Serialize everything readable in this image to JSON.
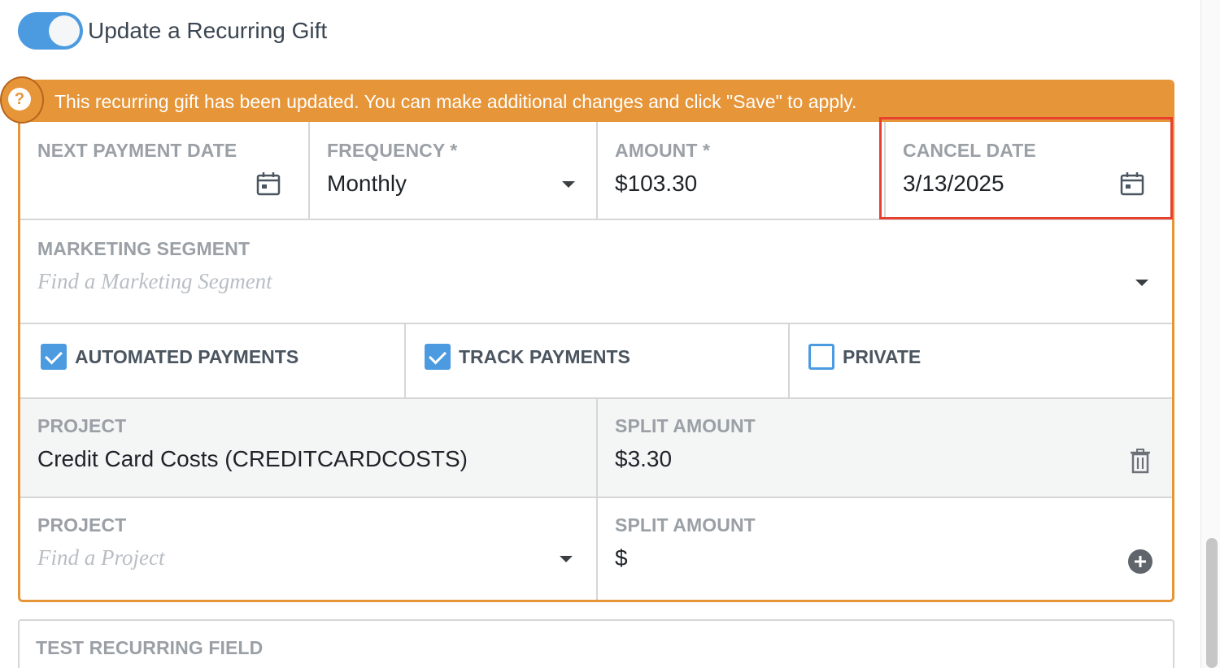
{
  "toggle": {
    "label": "Update a Recurring Gift",
    "on": true
  },
  "banner": {
    "text": "This recurring gift has been updated. You can make additional changes and click \"Save\" to apply.",
    "help_glyph": "?"
  },
  "fields": {
    "next_payment_date": {
      "label": "NEXT PAYMENT DATE",
      "value": ""
    },
    "frequency": {
      "label": "FREQUENCY *",
      "value": "Monthly"
    },
    "amount": {
      "label": "AMOUNT *",
      "value": "$103.30"
    },
    "cancel_date": {
      "label": "CANCEL DATE",
      "value": "3/13/2025"
    },
    "marketing_segment": {
      "label": "MARKETING SEGMENT",
      "placeholder": "Find a Marketing Segment"
    }
  },
  "checkboxes": [
    {
      "label": "AUTOMATED PAYMENTS",
      "checked": true
    },
    {
      "label": "TRACK PAYMENTS",
      "checked": true
    },
    {
      "label": "PRIVATE",
      "checked": false
    }
  ],
  "splits": [
    {
      "project_label": "PROJECT",
      "project_value": "Credit Card Costs (CREDITCARDCOSTS)",
      "amount_label": "SPLIT AMOUNT",
      "amount_value": "$3.30",
      "action_icon": "trash-icon"
    },
    {
      "project_label": "PROJECT",
      "project_placeholder": "Find a Project",
      "amount_label": "SPLIT AMOUNT",
      "amount_value": "$",
      "action_icon": "plus-circle-icon"
    }
  ],
  "test_field": {
    "label": "TEST RECURRING FIELD"
  },
  "colors": {
    "accent_blue": "#4c9be0",
    "banner_orange": "#e69538",
    "highlight_red": "#e8402f"
  }
}
